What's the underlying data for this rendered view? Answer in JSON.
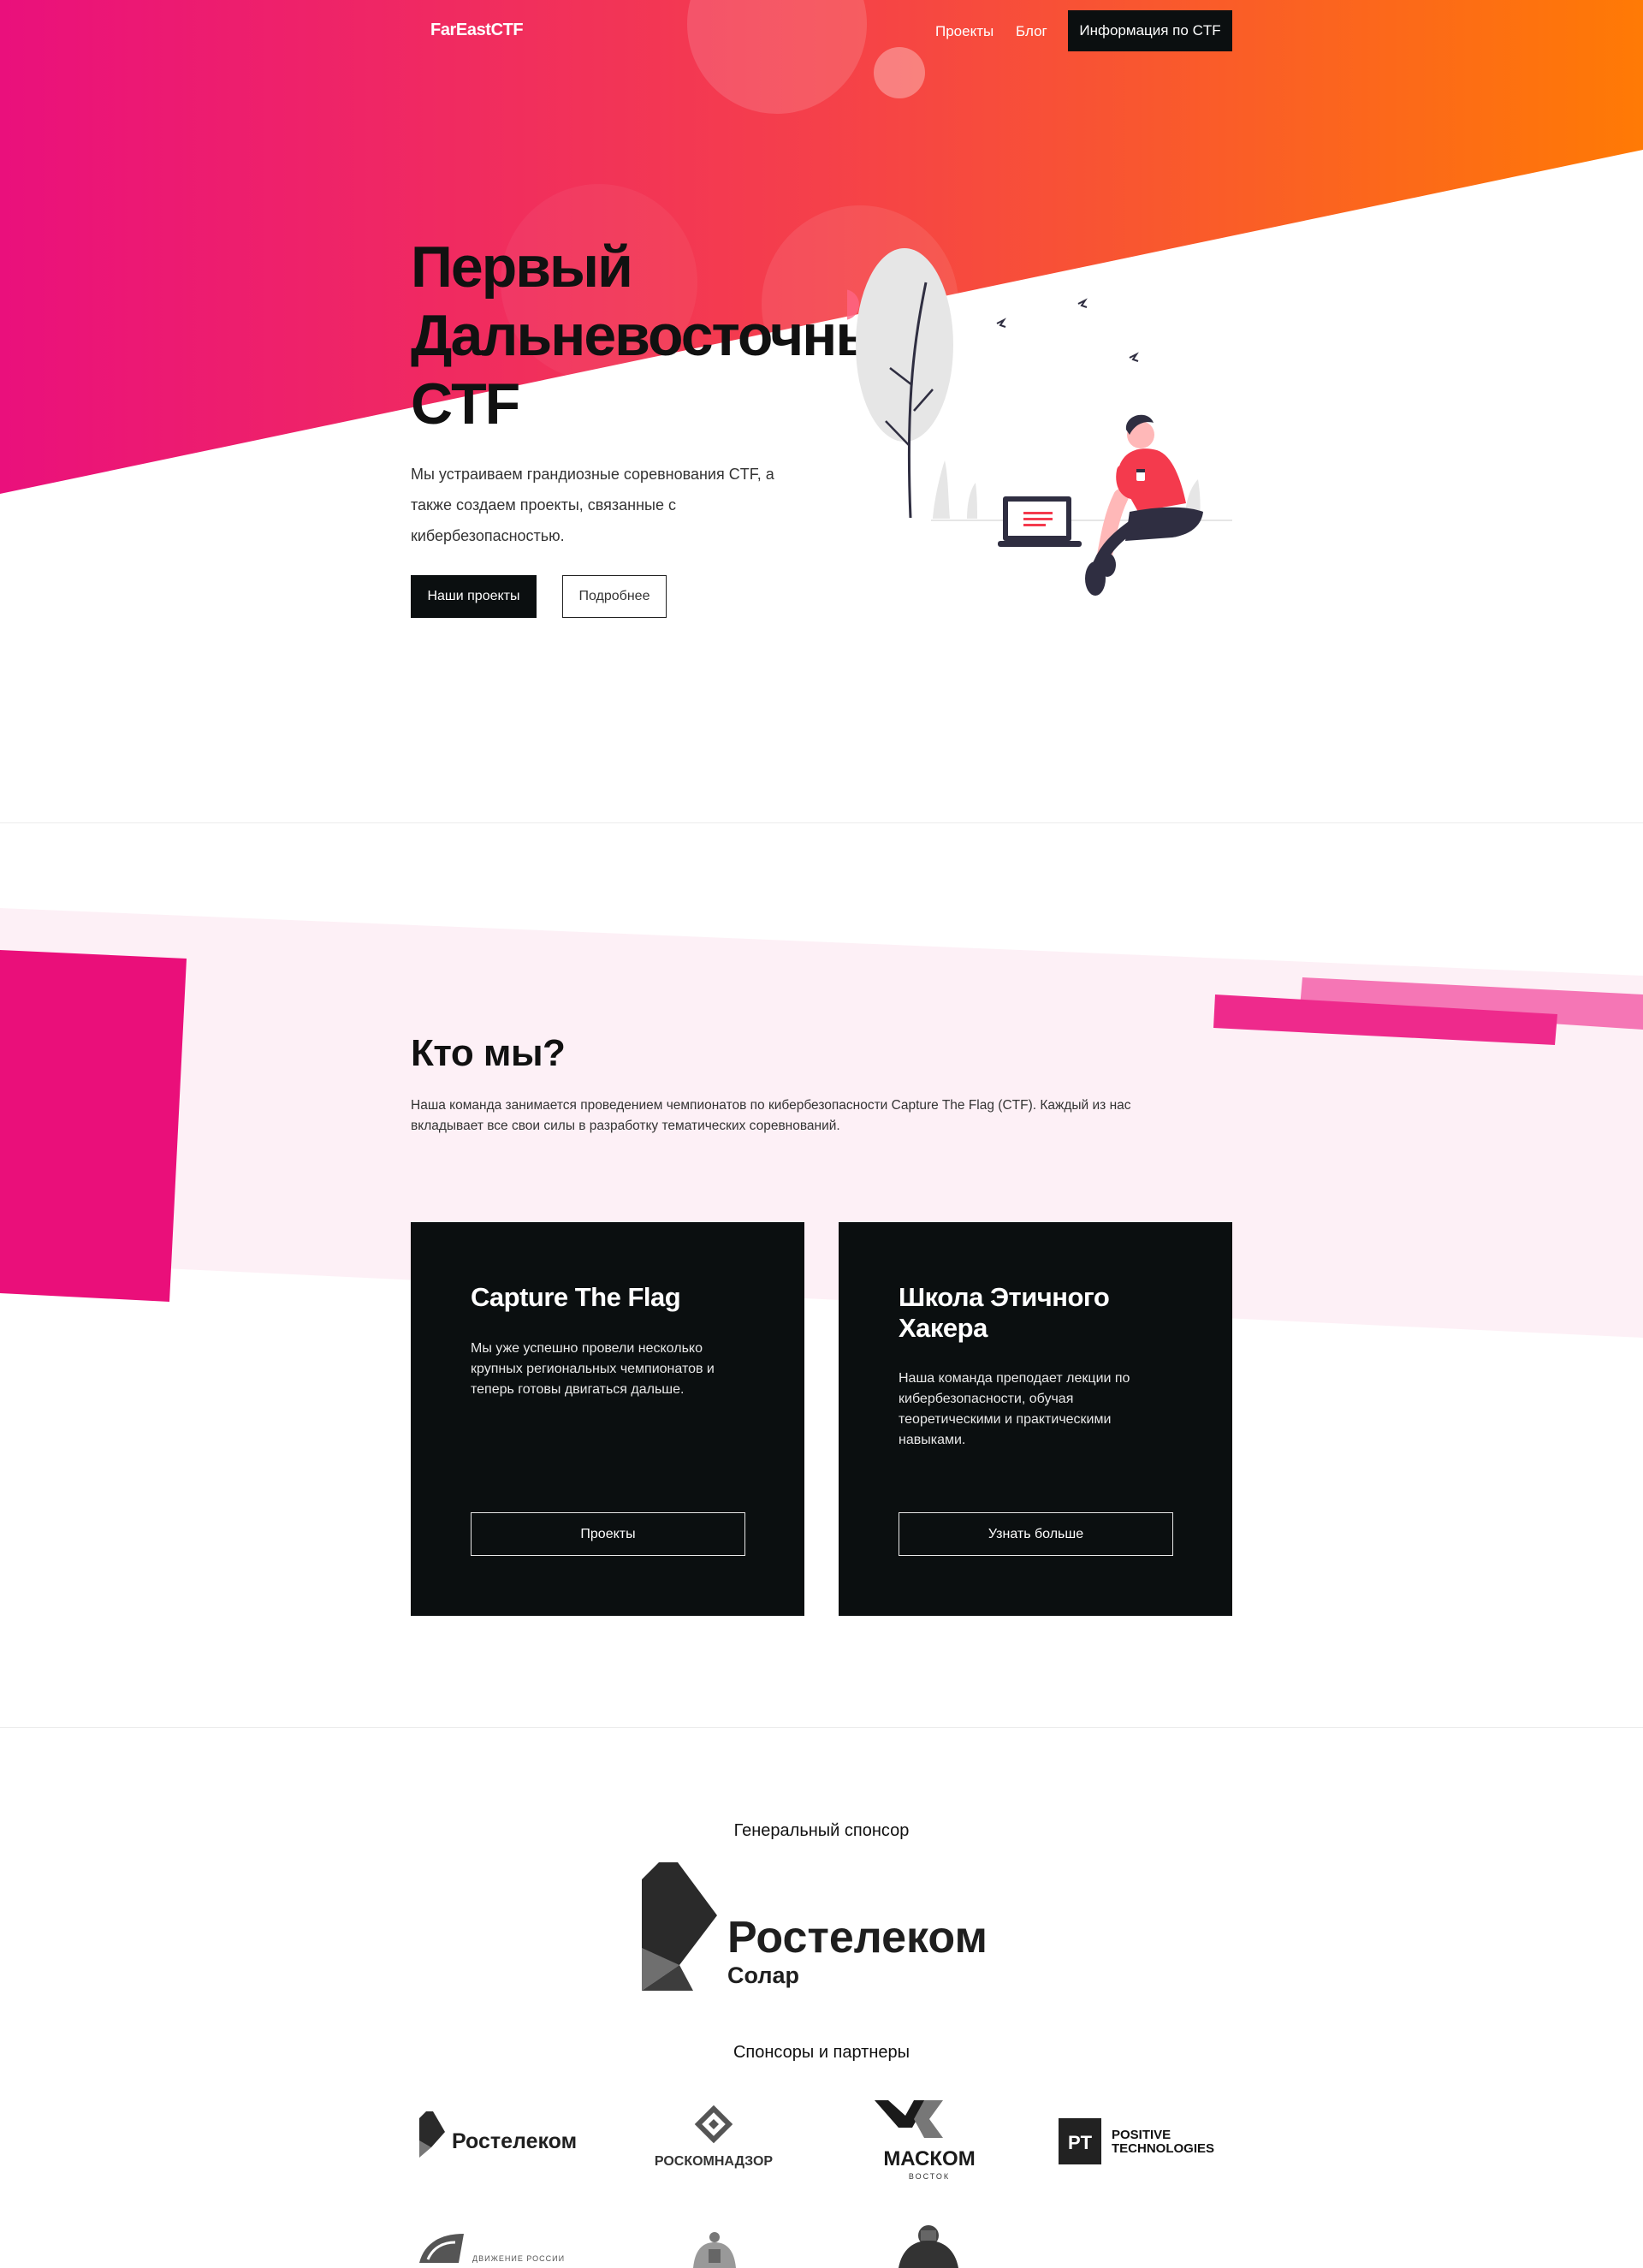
{
  "nav": {
    "brand": "FarEastCTF",
    "links": [
      "Проекты",
      "Блог"
    ],
    "cta": "Информация по CTF"
  },
  "hero": {
    "title_lines": [
      "Первый",
      "Дальневосточный",
      "CTF"
    ],
    "description_lines": [
      "Мы устраиваем грандиозные соревнования CTF, а",
      "также создаем проекты, связанные с",
      "кибербезопасностью."
    ],
    "primary_button": "Наши проекты",
    "secondary_button": "Подробнее"
  },
  "about": {
    "title": "Кто мы?",
    "description_lines": [
      "Наша команда занимается проведением чемпионатов по кибербезопасности Capture The Flag (CTF). Каждый из нас",
      "вкладывает все свои силы в разработку тематических соревнований."
    ],
    "cards": [
      {
        "title_lines": [
          "Capture The Flag"
        ],
        "text_lines": [
          "Мы уже успешно провели несколько",
          "крупных региональных чемпионатов и",
          "теперь готовы двигаться дальше."
        ],
        "button": "Проекты"
      },
      {
        "title_lines": [
          "Школа Этичного",
          "Хакера"
        ],
        "text_lines": [
          "Наша команда преподает лекции по",
          "кибербезопасности, обучая",
          "теоретическими и практическими",
          "навыками."
        ],
        "button": "Узнать больше"
      }
    ]
  },
  "sponsors": {
    "general_heading": "Генеральный спонсор",
    "general_logo": {
      "name": "Ростелеком",
      "sub": "Солар"
    },
    "partners_heading": "Спонсоры и партнеры",
    "partners": [
      {
        "name": "Ростелеком"
      },
      {
        "name": "РОСКОМНАДЗОР"
      },
      {
        "name": "МАСКОМ",
        "sub": "ВОСТОК"
      },
      {
        "name_lines": [
          "POSITIVE",
          "TECHNOLOGIES"
        ],
        "badge": "PT"
      },
      {
        "name": "ДВИЖЕНИЕ РОССИИ"
      }
    ]
  },
  "colors": {
    "gradient_start": "#e9127a",
    "gradient_mid": "#f43a4d",
    "gradient_end": "#ff7a05",
    "dark": "#0b0f10",
    "pink_light": "#fdf0f6",
    "pink_strong": "#ea0f7a"
  }
}
